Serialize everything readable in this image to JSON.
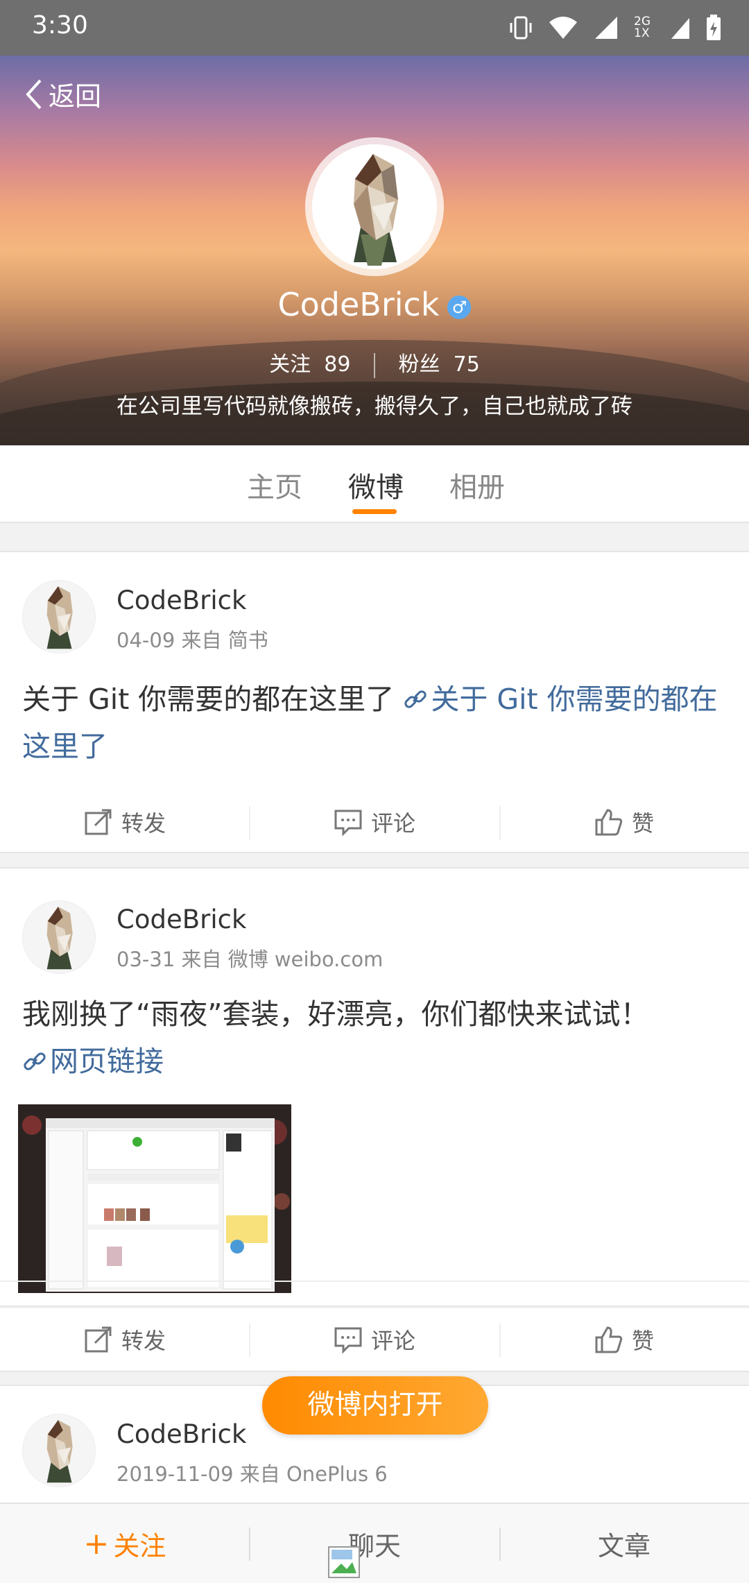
{
  "status_bar": {
    "time": "3:30",
    "network": "2G 1X"
  },
  "header": {
    "back_label": "返回",
    "name": "CodeBrick",
    "gender_symbol": "♂",
    "following_label": "关注",
    "following_count": "89",
    "followers_label": "粉丝",
    "followers_count": "75",
    "bio": "在公司里写代码就像搬砖，搬得久了，自己也就成了砖"
  },
  "tabs": [
    {
      "label": "主页",
      "active": false
    },
    {
      "label": "微博",
      "active": true
    },
    {
      "label": "相册",
      "active": false
    }
  ],
  "posts": [
    {
      "author": "CodeBrick",
      "meta": "04-09 来自 简书",
      "text": "关于 Git 你需要的都在这里了 ",
      "link": "关于 Git 你需要的都在这里了",
      "actions": {
        "repost": "转发",
        "comment": "评论",
        "like": "赞"
      }
    },
    {
      "author": "CodeBrick",
      "meta": "03-31 来自 微博 weibo.com",
      "text": "我刚换了“雨夜”套装，好漂亮，你们都快来试试！",
      "link": "网页链接",
      "actions": {
        "repost": "转发",
        "comment": "评论",
        "like": "赞"
      }
    },
    {
      "author": "CodeBrick",
      "meta": "2019-11-09 来自 OnePlus 6"
    }
  ],
  "open_in_app_label": "微博内打开",
  "bottom_bar": {
    "follow": "关注",
    "follow_prefix": "+",
    "chat": "聊天",
    "articles": "文章"
  },
  "colors": {
    "accent": "#ff8200",
    "link": "#426b9c",
    "gender_badge": "#5aa9f0"
  }
}
